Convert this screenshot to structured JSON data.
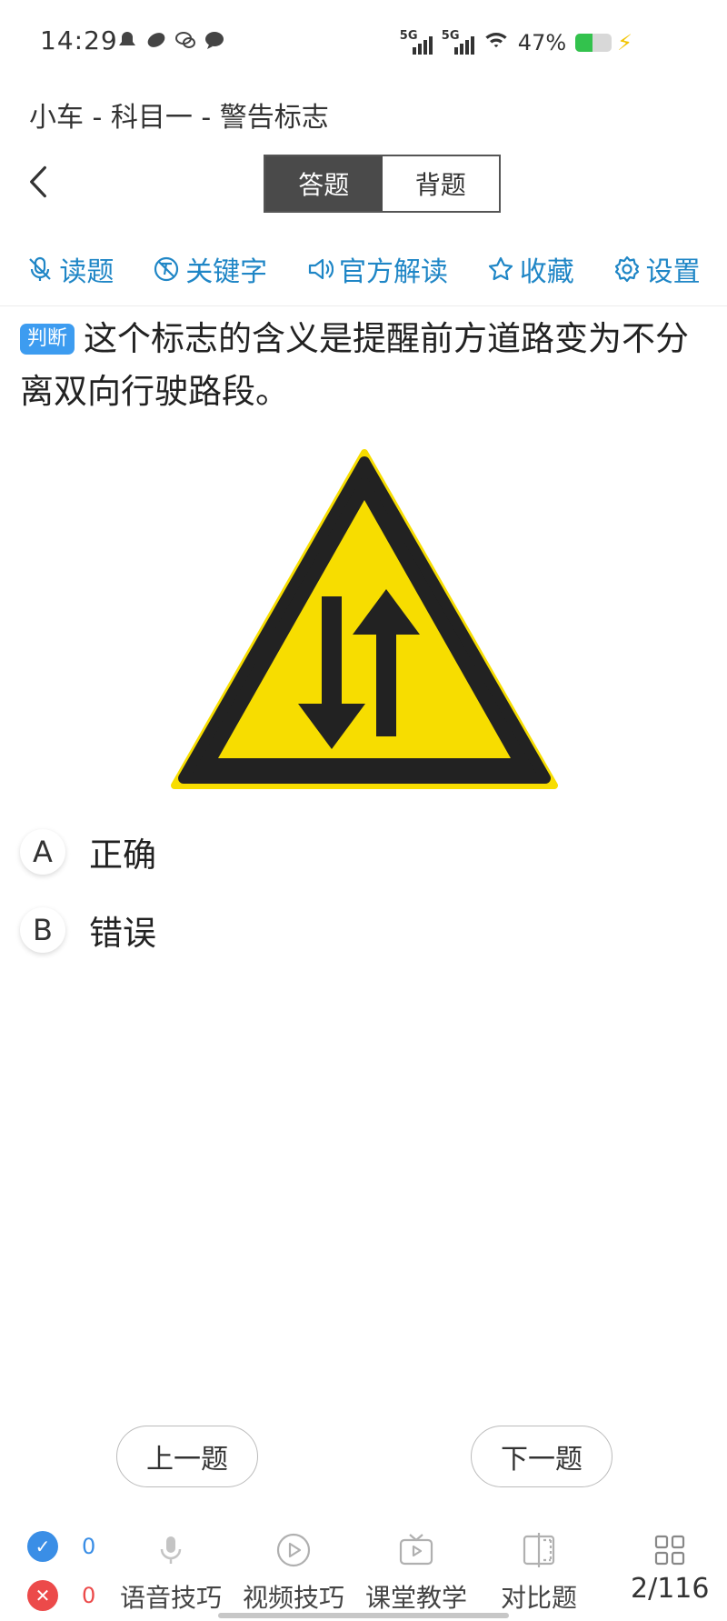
{
  "status_bar": {
    "time": "14:29",
    "signal_1_label": "5G",
    "signal_2_label": "5G",
    "battery_percent": "47%",
    "battery_level": 0.47,
    "icons": [
      "notification-icon",
      "android-icon",
      "game-icon",
      "wechat-icon",
      "message-icon",
      "wifi-icon",
      "battery-icon",
      "charging-icon"
    ]
  },
  "header": {
    "title": "小车 - 科目一 - 警告标志",
    "tabs": [
      {
        "label": "答题",
        "active": true
      },
      {
        "label": "背题",
        "active": false
      }
    ]
  },
  "toolbar": {
    "items": [
      {
        "label": "读题",
        "icon": "mic-off-icon"
      },
      {
        "label": "关键字",
        "icon": "keyword-icon"
      },
      {
        "label": "官方解读",
        "icon": "speaker-icon"
      },
      {
        "label": "收藏",
        "icon": "star-icon"
      },
      {
        "label": "设置",
        "icon": "gear-icon"
      }
    ]
  },
  "question": {
    "type_badge": "判断",
    "text": "这个标志的含义是提醒前方道路变为不分离双向行驶路段。",
    "image": "two-way-traffic-warning-sign"
  },
  "options": [
    {
      "letter": "A",
      "text": "正确"
    },
    {
      "letter": "B",
      "text": "错误"
    }
  ],
  "navigation": {
    "prev_label": "上一题",
    "next_label": "下一题"
  },
  "bottom_bar": {
    "correct_count": "0",
    "wrong_count": "0",
    "items": [
      {
        "label": "语音技巧",
        "icon": "microphone-icon"
      },
      {
        "label": "视频技巧",
        "icon": "play-icon"
      },
      {
        "label": "课堂教学",
        "icon": "tv-icon"
      },
      {
        "label": "对比题",
        "icon": "compare-icon"
      }
    ],
    "progress": "2/116"
  },
  "colors": {
    "accent_blue": "#1f86c6",
    "badge_blue": "#3d9cf0",
    "sign_yellow": "#f7dd00",
    "correct_blue": "#3a8ee6",
    "wrong_red": "#ec4a4a"
  }
}
